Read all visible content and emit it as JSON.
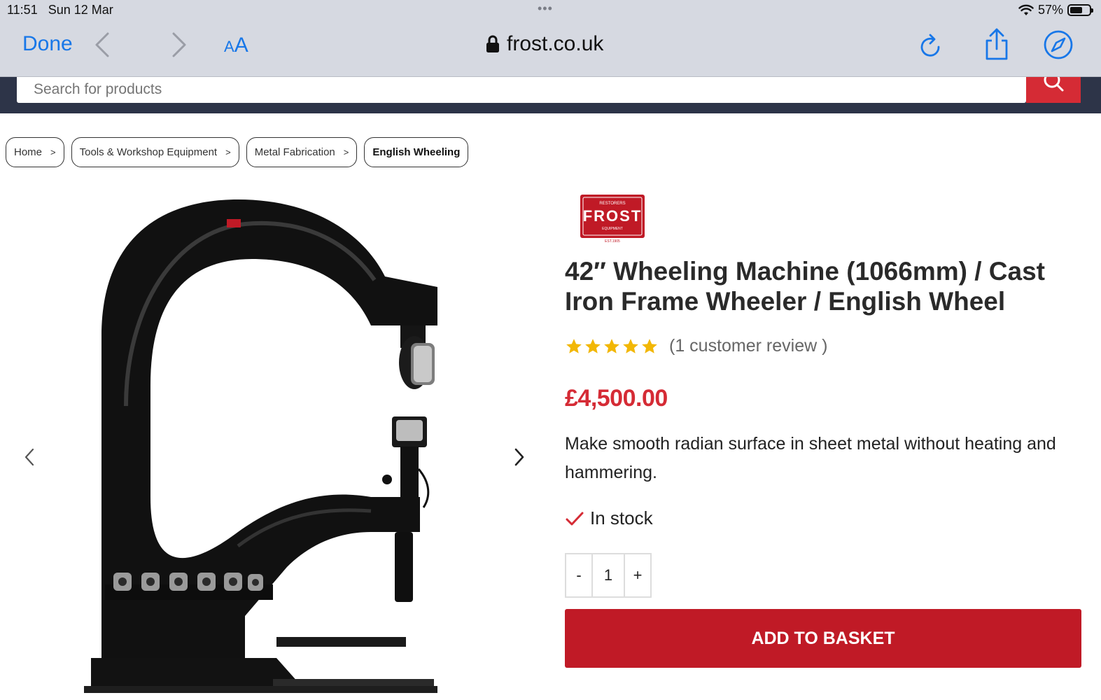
{
  "status_bar": {
    "time": "11:51",
    "date": "Sun 12 Mar",
    "battery": "57%",
    "dots": "•••"
  },
  "browser": {
    "done_label": "Done",
    "text_size_label_small": "A",
    "text_size_label_large": "A",
    "url": "frost.co.uk",
    "icons": [
      "chevron-left-icon",
      "chevron-right-icon",
      "lock-icon",
      "reload-icon",
      "share-icon",
      "compass-icon"
    ]
  },
  "search": {
    "placeholder": "Search for products"
  },
  "breadcrumbs": [
    {
      "label": "Home",
      "sep": ">"
    },
    {
      "label": "Tools & Workshop Equipment",
      "sep": ">"
    },
    {
      "label": "Metal Fabrication",
      "sep": ">"
    },
    {
      "label": "English Wheeling"
    }
  ],
  "brand": {
    "top_text": "RESTORERS",
    "name": "FROST",
    "sub_text": "EQUIPMENT",
    "est": "EST.1905",
    "color": "#c01a26"
  },
  "product": {
    "title": "42″ Wheeling Machine (1066mm) / Cast Iron Frame Wheeler / English Wheel",
    "rating_stars": 5,
    "review_text": "(1 customer review )",
    "price": "£4,500.00",
    "description": "Make smooth radian surface in sheet metal without heating and hammering.",
    "stock": "In stock",
    "quantity": "1",
    "qty_minus": "-",
    "qty_plus": "+",
    "add_to_basket": "ADD TO BASKET"
  },
  "colors": {
    "accent_red": "#d52b35",
    "button_red": "#c01a26",
    "star": "#f2b705",
    "ios_blue": "#1877e8",
    "header_navy": "#2d3448"
  }
}
